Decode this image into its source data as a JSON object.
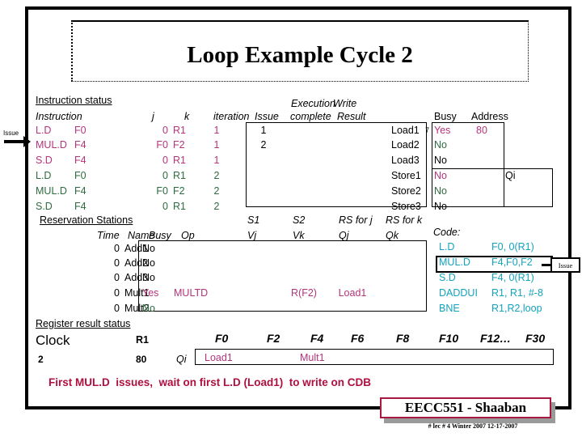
{
  "slide": {
    "title": "Loop Example Cycle 2",
    "caption": "First MUL.D  issues,  wait on first L.D (Load1)  to write on CDB",
    "banner": "EECC551 - Shaaban",
    "footer": "#  lec # 4  Winter 2007    12-17-2007",
    "issue_arrow_label": "Issue",
    "issue_callout_label": "Issue"
  },
  "colors": {
    "iteration1": "#b4347b",
    "iteration2": "#2d6b3f",
    "code": "#14a3bd",
    "caption": "#b01040",
    "banner_border": "#a81840"
  },
  "instruction_status": {
    "section_label": "Instruction status",
    "headers": {
      "instruction": "Instruction",
      "j": "j",
      "k": "k",
      "iteration": "iteration",
      "issue": "Issue",
      "execution": "Execution",
      "complete": "complete",
      "write": "Write",
      "result": "Result"
    },
    "rows": [
      {
        "instruction": "L.D",
        "dest": "F0",
        "j": "0",
        "k": "R1",
        "iteration": "1",
        "issue": "1",
        "exec_complete": "",
        "write_result": "",
        "color": "pink"
      },
      {
        "instruction": "MUL.D",
        "dest": "F4",
        "j": "F0",
        "k": "F2",
        "iteration": "1",
        "issue": "2",
        "exec_complete": "",
        "write_result": "",
        "color": "pink"
      },
      {
        "instruction": "S.D",
        "dest": "F4",
        "j": "0",
        "k": "R1",
        "iteration": "1",
        "issue": "",
        "exec_complete": "",
        "write_result": "",
        "color": "pink"
      },
      {
        "instruction": "L.D",
        "dest": "F0",
        "j": "0",
        "k": "R1",
        "iteration": "2",
        "issue": "",
        "exec_complete": "",
        "write_result": "",
        "color": "green"
      },
      {
        "instruction": "MUL.D",
        "dest": "F4",
        "j": "F0",
        "k": "F2",
        "iteration": "2",
        "issue": "",
        "exec_complete": "",
        "write_result": "",
        "color": "green"
      },
      {
        "instruction": "S.D",
        "dest": "F4",
        "j": "0",
        "k": "R1",
        "iteration": "2",
        "issue": "",
        "exec_complete": "",
        "write_result": "",
        "color": "green"
      }
    ]
  },
  "load_store_buffers": {
    "headers": {
      "busy": "Busy",
      "address": "Address",
      "qi": "Qi"
    },
    "marker": "7",
    "rows": [
      {
        "name": "Load1",
        "busy": "Yes",
        "address": "80",
        "color": "pink"
      },
      {
        "name": "Load2",
        "busy": "No",
        "address": "",
        "color": "green"
      },
      {
        "name": "Load3",
        "busy": "No",
        "address": "",
        "color": "black"
      },
      {
        "name": "Store1",
        "busy": "No",
        "address": "",
        "color": "pink"
      },
      {
        "name": "Store2",
        "busy": "No",
        "address": "",
        "color": "green"
      },
      {
        "name": "Store3",
        "busy": "No",
        "address": "",
        "color": "black"
      }
    ]
  },
  "reservation_stations": {
    "section_label": "Reservation Stations",
    "headers": {
      "time": "Time",
      "name": "Name",
      "busy": "Busy",
      "op": "Op",
      "s1": "S1",
      "s2": "S2",
      "rs_for_j": "RS for j",
      "rs_for_k": "RS for k",
      "vj": "Vj",
      "vk": "Vk",
      "qj": "Qj",
      "qk": "Qk"
    },
    "rows": [
      {
        "time": "0",
        "name": "Add1",
        "busy": "No",
        "op": "",
        "vj": "",
        "vk": "",
        "qj": "",
        "qk": "",
        "color": "black"
      },
      {
        "time": "0",
        "name": "Add2",
        "busy": "No",
        "op": "",
        "vj": "",
        "vk": "",
        "qj": "",
        "qk": "",
        "color": "black"
      },
      {
        "time": "0",
        "name": "Add3",
        "busy": "No",
        "op": "",
        "vj": "",
        "vk": "",
        "qj": "",
        "qk": "",
        "color": "black"
      },
      {
        "time": "0",
        "name": "Mult1",
        "busy": "Yes",
        "op": "MULTD",
        "vj": "",
        "vk": "R(F2)",
        "qj": "Load1",
        "qk": "",
        "color": "pink"
      },
      {
        "time": "0",
        "name": "Mult2",
        "busy": "No",
        "op": "",
        "vj": "",
        "vk": "",
        "qj": "",
        "qk": "",
        "color": "green"
      }
    ]
  },
  "code": {
    "label": "Code:",
    "highlight_index": 1,
    "lines": [
      {
        "op": "L.D",
        "args": "F0, 0(R1)"
      },
      {
        "op": "MUL.D",
        "args": "F4,F0,F2"
      },
      {
        "op": "S.D",
        "args": "F4, 0(R1)"
      },
      {
        "op": "DADDUI",
        "args": "R1, R1, #-8"
      },
      {
        "op": "BNE",
        "args": "R1,R2,loop"
      }
    ]
  },
  "register_result_status": {
    "section_label": "Register result status",
    "clock_label": "Clock",
    "clock_value": "2",
    "r1_label": "R1",
    "r1_value": "80",
    "qi_label": "Qi",
    "registers": [
      "F0",
      "F2",
      "F4",
      "F6",
      "F8",
      "F10",
      "F12…",
      "F30"
    ],
    "values": [
      {
        "reg": "F0",
        "value": "Load1",
        "color": "pink"
      },
      {
        "reg": "F4",
        "value": "Mult1",
        "color": "pink"
      }
    ]
  }
}
